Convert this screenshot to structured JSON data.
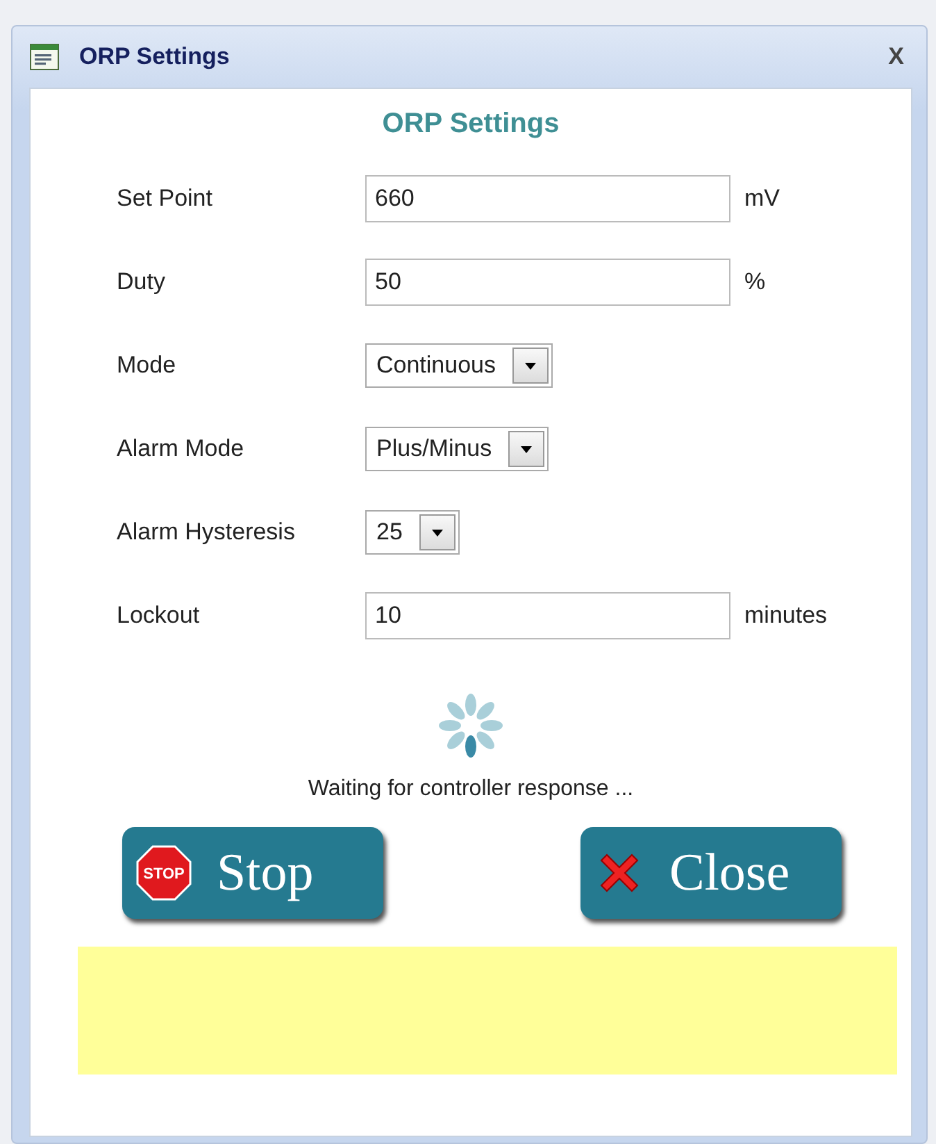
{
  "window": {
    "title": "ORP Settings",
    "close_glyph": "X"
  },
  "heading": "ORP Settings",
  "fields": [
    {
      "kind": "text",
      "label": "Set Point",
      "value": "660",
      "unit": "mV"
    },
    {
      "kind": "text",
      "label": "Duty",
      "value": "50",
      "unit": "%"
    },
    {
      "kind": "select",
      "label": "Mode",
      "value": "Continuous"
    },
    {
      "kind": "select",
      "label": "Alarm Mode",
      "value": "Plus/Minus"
    },
    {
      "kind": "select",
      "label": "Alarm Hysteresis",
      "value": "25"
    },
    {
      "kind": "text",
      "label": "Lockout",
      "value": "10",
      "unit": "minutes"
    }
  ],
  "status": "Waiting for controller response ...",
  "buttons": [
    {
      "kind": "stop",
      "label": "Stop",
      "icon_text": "STOP"
    },
    {
      "kind": "close",
      "label": "Close"
    }
  ]
}
